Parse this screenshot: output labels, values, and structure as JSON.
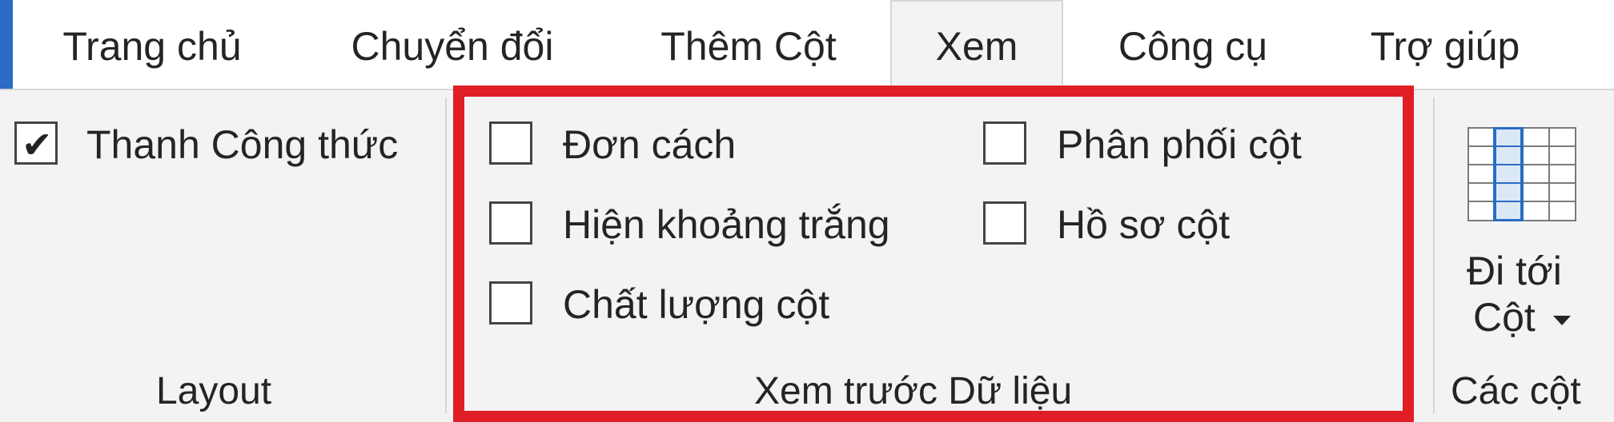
{
  "tabs": [
    {
      "label": "Trang chủ",
      "active": false
    },
    {
      "label": "Chuyển đổi",
      "active": false
    },
    {
      "label": "Thêm Cột",
      "active": false
    },
    {
      "label": "Xem",
      "active": true
    },
    {
      "label": "Công cụ",
      "active": false
    },
    {
      "label": "Trợ giúp",
      "active": false
    }
  ],
  "layout_group": {
    "formula_bar": {
      "label": "Thanh Công thức",
      "checked": true
    },
    "group_label": "Layout"
  },
  "data_preview_group": {
    "monospaced": {
      "label": "Đơn cách",
      "checked": false
    },
    "show_whitespace": {
      "label": "Hiện khoảng trắng",
      "checked": false
    },
    "column_quality": {
      "label": "Chất lượng cột",
      "checked": false
    },
    "column_distribution": {
      "label": "Phân phối cột",
      "checked": false
    },
    "column_profile": {
      "label": "Hồ sơ cột",
      "checked": false
    },
    "group_label": "Xem trước Dữ liệu"
  },
  "columns_group": {
    "goto_line1": "Đi tới",
    "goto_line2": "Cột",
    "goto_icon": "table-column-icon",
    "group_label": "Các cột"
  },
  "colors": {
    "accent": "#2b6cc4",
    "highlight": "#e01e26",
    "background": "#f3f3f3"
  }
}
